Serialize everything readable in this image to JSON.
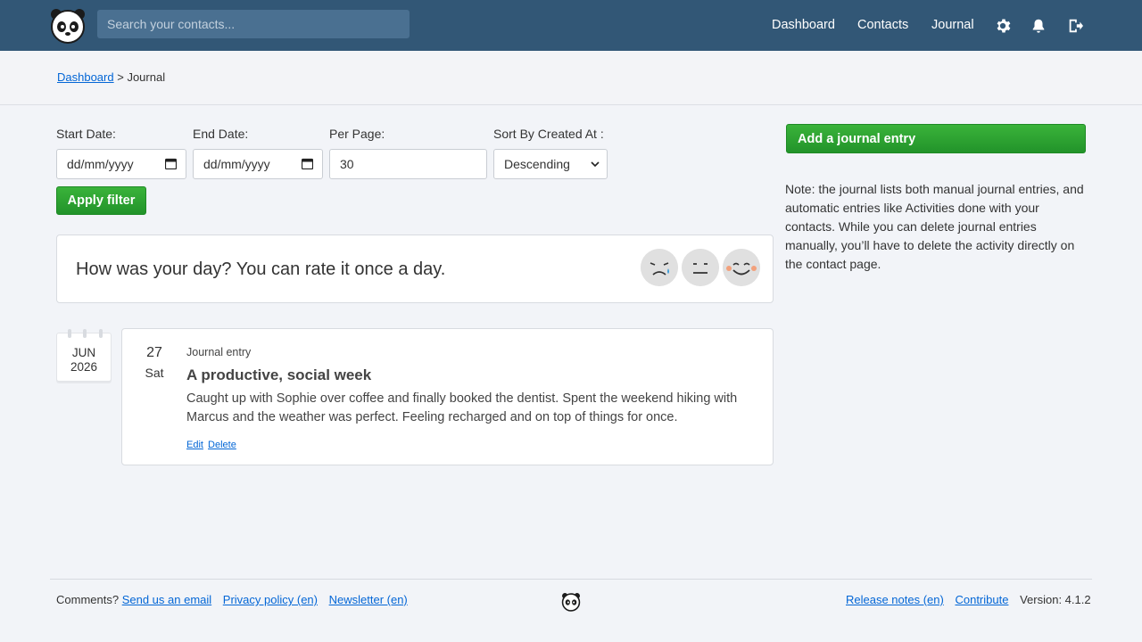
{
  "header": {
    "search_placeholder": "Search your contacts...",
    "nav": [
      "Dashboard",
      "Contacts",
      "Journal"
    ],
    "icons": [
      "gear-icon",
      "bell-icon",
      "logout-icon"
    ],
    "bg_color": "#325776"
  },
  "breadcrumb": {
    "home": "Dashboard",
    "separator": ">",
    "current": "Journal"
  },
  "filters": {
    "start_label": "Start Date:",
    "start_value": "dd/mm/yyyy",
    "end_label": "End Date:",
    "end_value": "dd/mm/yyyy",
    "per_page_label": "Per Page:",
    "per_page_value": "30",
    "sort_label": "Sort By Created At :",
    "sort_value": "Descending",
    "apply_label": "Apply filter"
  },
  "mood": {
    "prompt": "How was your day? You can rate it once a day.",
    "options": [
      "sad-face-icon",
      "neutral-face-icon",
      "happy-face-icon"
    ]
  },
  "entry": {
    "month": "JUN",
    "year": "2026",
    "day": "27",
    "weekday": "Sat",
    "type": "Journal entry",
    "title": "A productive, social week",
    "body": "Caught up with Sophie over coffee and finally booked the dentist. Spent the weekend hiking with Marcus and the weather was perfect. Feeling recharged and on top of things for once.",
    "edit_label": "Edit",
    "delete_label": "Delete"
  },
  "sidebar": {
    "add_button": "Add a journal entry",
    "note": "Note: the journal lists both manual journal entries, and automatic entries like Activities done with your contacts. While you can delete journal entries manually, you’ll have to delete the activity directly on the contact page."
  },
  "footer": {
    "comments_label": "Comments?",
    "email_link": "Send us an email",
    "privacy_link": "Privacy policy (en)",
    "newsletter_link": "Newsletter (en)",
    "release_link": "Release notes (en)",
    "contribute_link": "Contribute",
    "version": "Version: 4.1.2"
  },
  "colors": {
    "accent_green": "#2aa032",
    "link": "#0366d6"
  }
}
